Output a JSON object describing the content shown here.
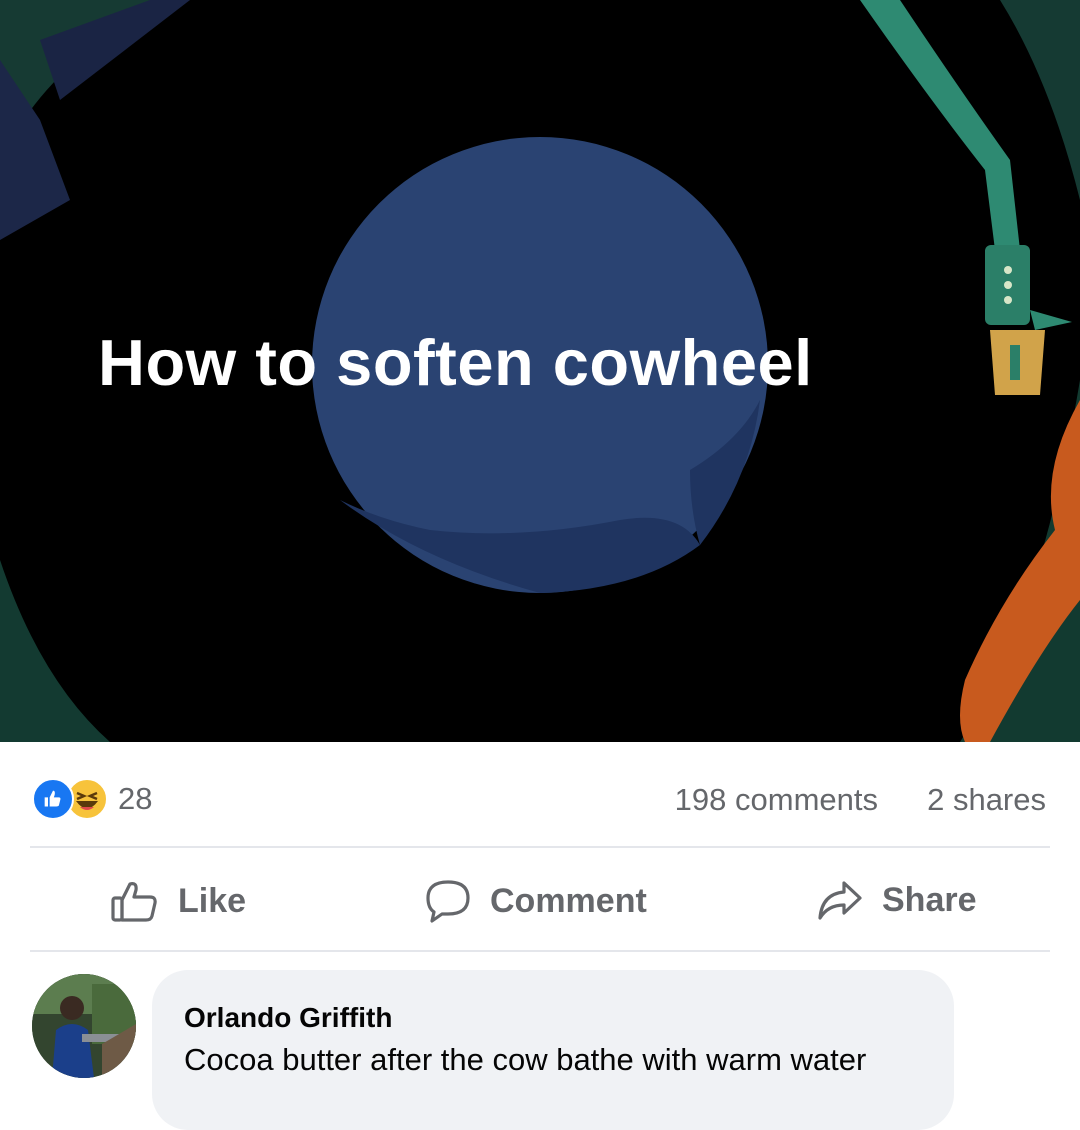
{
  "post": {
    "image_title": "How to  soften cowheel",
    "reaction_count": "28",
    "comments_count": "198 comments",
    "shares_count": "2 shares"
  },
  "actions": {
    "like_label": "Like",
    "comment_label": "Comment",
    "share_label": "Share"
  },
  "comment": {
    "author": "Orlando Griffith",
    "text": "Cocoa butter after the cow bathe with warm water"
  },
  "colors": {
    "like_blue": "#1877f2",
    "meta_gray": "#65676b",
    "bubble_bg": "#f0f2f5",
    "record_blue": "#2a4372"
  },
  "icons": [
    "like-reaction-icon",
    "haha-reaction-icon",
    "thumbs-up-icon",
    "comment-icon",
    "share-icon"
  ]
}
